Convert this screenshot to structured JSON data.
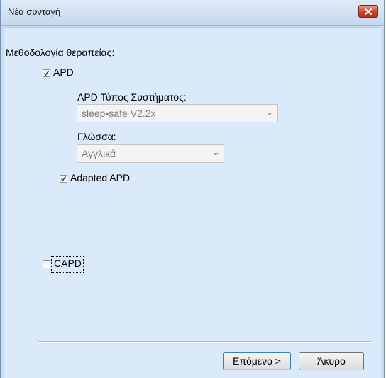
{
  "window": {
    "title": "Νέα συνταγή",
    "close_icon": "close-icon"
  },
  "form": {
    "methodology_label": "Μεθοδολογία θεραπείας:",
    "apd": {
      "label": "APD",
      "checked": true,
      "system_type_label": "APD Τύπος Συστήματος:",
      "system_type_value": "sleep•safe V2.2x",
      "language_label": "Γλώσσα:",
      "language_value": "Αγγλικά",
      "adapted_label": "Adapted APD",
      "adapted_checked": true
    },
    "capd": {
      "label": "CAPD",
      "checked": false
    }
  },
  "buttons": {
    "next_label": "Επόμενο >",
    "cancel_label": "Άκυρο"
  }
}
